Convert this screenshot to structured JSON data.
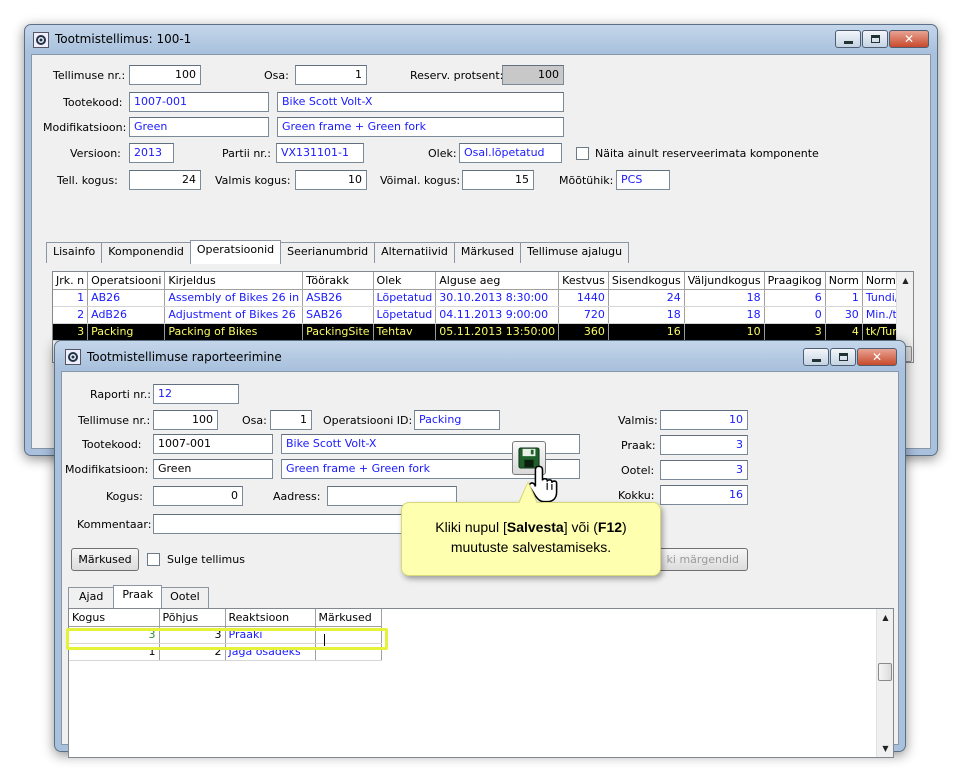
{
  "main_window": {
    "title": "Tootmistellimus: 100-1",
    "fields": {
      "order_no_label": "Tellimuse nr.:",
      "order_no": "100",
      "part_label": "Osa:",
      "part": "1",
      "reserve_label": "Reserv. protsent:",
      "reserve": "100",
      "product_code_label": "Tootekood:",
      "product_code": "1007-001",
      "product_name": "Bike Scott Volt-X",
      "modification_label": "Modifikatsioon:",
      "modification": "Green",
      "modification_desc": "Green frame + Green fork",
      "version_label": "Versioon:",
      "version": "2013",
      "batch_label": "Partii nr.:",
      "batch": "VX131101-1",
      "status_label": "Olek:",
      "status": "Osal.lõpetatud",
      "show_unreserved_label": "Näita ainult reserveerimata komponente",
      "ordered_qty_label": "Tell. kogus:",
      "ordered_qty": "24",
      "done_qty_label": "Valmis kogus:",
      "done_qty": "10",
      "possible_qty_label": "Võimal. kogus:",
      "possible_qty": "15",
      "unit_label": "Mõõtühik:",
      "unit": "PCS"
    },
    "tabs": [
      "Lisainfo",
      "Komponendid",
      "Operatsioonid",
      "Seerianumbrid",
      "Alternatiivid",
      "Märkused",
      "Tellimuse ajalugu"
    ],
    "ops_table": {
      "headers": [
        "Jrk. n",
        "Operatsiooni",
        "Kirjeldus",
        "Töörakk",
        "Olek",
        "Alguse aeg",
        "Kestvus",
        "Sisendkogus",
        "Väljundkogus",
        "Praagikog",
        "Norm",
        "Normi üh"
      ],
      "rows": [
        [
          "1",
          "AB26",
          "Assembly of Bikes 26 in",
          "ASB26",
          "Lõpetatud",
          "30.10.2013 8:30:00",
          "1440",
          "24",
          "18",
          "6",
          "1",
          "Tundi/tk"
        ],
        [
          "2",
          "AdB26",
          "Adjustment of Bikes 26",
          "SAB26",
          "Lõpetatud",
          "04.11.2013 9:00:00",
          "720",
          "18",
          "18",
          "0",
          "30",
          "Min./tk"
        ],
        [
          "3",
          "Packing",
          "Packing of Bikes",
          "PackingSite",
          "Tehtav",
          "05.11.2013 13:50:00",
          "360",
          "16",
          "10",
          "3",
          "4",
          "tk/Tunnis"
        ]
      ]
    }
  },
  "report_window": {
    "title": "Tootmistellimuse raporteerimine",
    "fields": {
      "report_no_label": "Raporti nr.:",
      "report_no": "12",
      "order_no_label": "Tellimuse nr.:",
      "order_no": "100",
      "part_label": "Osa:",
      "part": "1",
      "op_id_label": "Operatsiooni ID:",
      "op_id": "Packing",
      "product_code_label": "Tootekood:",
      "product_code": "1007-001",
      "product_name": "Bike Scott Volt-X",
      "modification_label": "Modifikatsioon:",
      "modification": "Green",
      "modification_desc": "Green frame + Green fork",
      "qty_label": "Kogus:",
      "qty": "0",
      "address_label": "Aadress:",
      "address": "",
      "comment_label": "Kommentaar:",
      "comment": "",
      "done_label": "Valmis:",
      "done": "10",
      "scrap_label": "Praak:",
      "scrap": "3",
      "waiting_label": "Ootel:",
      "waiting": "3",
      "total_label": "Kokku:",
      "total": "16"
    },
    "notes_button": "Märkused",
    "close_order_label": "Sulge tellimus",
    "marks_button_partial": "ki märgendid",
    "tabs": [
      "Ajad",
      "Praak",
      "Ootel"
    ],
    "scrap_table": {
      "headers": [
        "Kogus",
        "Põhjus",
        "Reaktsioon",
        "Märkused"
      ],
      "rows": [
        [
          "3",
          "3",
          "Praaki",
          ""
        ],
        [
          "1",
          "2",
          "Jaga osadeks",
          ""
        ]
      ]
    }
  },
  "callout": {
    "line1_pre": "Kliki nupul [",
    "line1_bold": "Salvesta",
    "line1_mid": "] või (",
    "line1_key": "F12",
    "line1_post": ")",
    "line2": "muutuste salvestamiseks."
  },
  "colors": {
    "accent_blue": "#1a1aff",
    "selected_row_bg": "#000000",
    "selected_row_fg": "#ffff66",
    "highlight": "#e6f23a",
    "callout_bg": "#ffffb0"
  }
}
